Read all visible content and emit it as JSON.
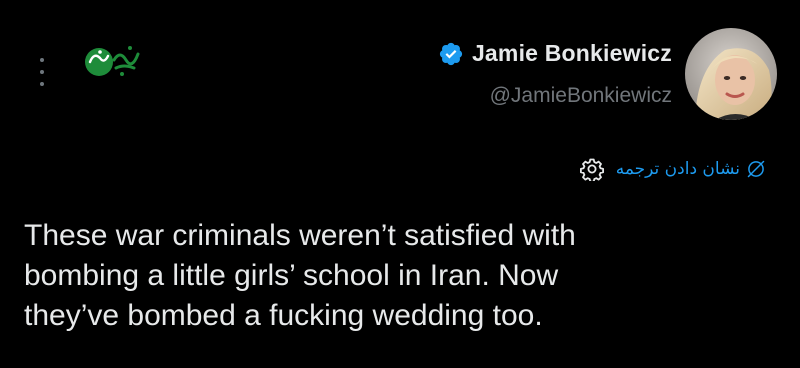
{
  "tweet": {
    "author": {
      "display_name": "Jamie Bonkiewicz",
      "handle": "@JamieBonkiewicz",
      "verified": true,
      "avatar_icon": "avatar-photo"
    },
    "translate_label": "نشان دادن ترجمه",
    "text": "These war criminals weren’t satisfied with\nbombing a little girls’ school in Iran. Now\nthey’ve bombed a fucking wedding too."
  },
  "watermark": {
    "logo_text": "خبر فوری",
    "color": "#1e8c3a"
  },
  "colors": {
    "background": "#000000",
    "primary_text": "#e7e9ea",
    "secondary_text": "#71767b",
    "accent": "#1d9bf0"
  },
  "icons": {
    "more": "more-vertical-icon",
    "verified": "verified-badge-icon",
    "settings": "gear-icon",
    "translate": "globe-slash-icon"
  }
}
